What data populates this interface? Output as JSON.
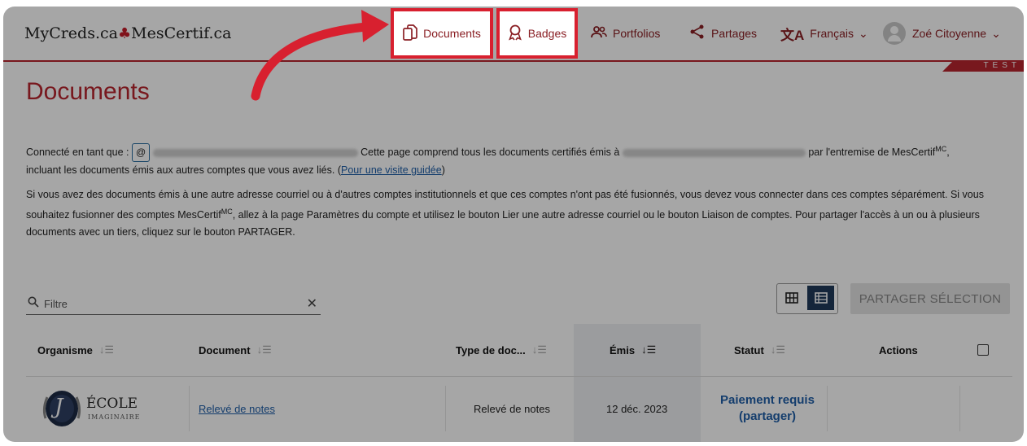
{
  "header": {
    "logo_left": "MyCreds.ca",
    "logo_right": "MesCertif.ca",
    "nav": {
      "documents": "Documents",
      "badges": "Badges",
      "portfolios": "Portfolios",
      "partages": "Partages",
      "language": "Français",
      "user": "Zoé Citoyenne"
    },
    "test_ribbon": "TEST"
  },
  "page": {
    "title": "Documents",
    "connected_as": "Connecté en tant que :",
    "at_symbol": "@",
    "para1_mid": "Cette page comprend tous les documents certifiés émis à",
    "para1_end": "par l'entremise de MesCertif",
    "mc": "MC",
    "para1_line2": "incluant les documents émis aux autres comptes que vous avez liés.",
    "guided_tour": "Pour une visite guidée",
    "para2_a": "Si vous avez des documents émis à une autre adresse courriel ou à d'autres comptes institutionnels et que ces comptes n'ont pas été fusionnés, vous devez vous connecter dans ces comptes séparément. Si vous souhaitez fusionner des comptes MesCertif",
    "para2_b": ", allez à la page Paramètres du compte et utilisez le bouton Lier une autre adresse courriel ou le bouton Liaison de comptes. Pour partager l'accès à un ou à plusieurs documents avec un tiers, cliquez sur le bouton PARTAGER."
  },
  "filter": {
    "placeholder": "Filtre",
    "clear": "✕"
  },
  "share_selection": "PARTAGER SÉLECTION",
  "table": {
    "headers": {
      "organisme": "Organisme",
      "document": "Document",
      "type": "Type de doc...",
      "emis": "Émis",
      "statut": "Statut",
      "actions": "Actions"
    },
    "rows": [
      {
        "org_name": "ÉCOLE",
        "org_sub": "IMAGINAIRE",
        "org_initial": "J",
        "document": "Relevé de notes",
        "type": "Relevé de notes",
        "emis": "12 déc. 2023",
        "status_line1": "Paiement requis",
        "status_line2": "(partager)"
      }
    ]
  },
  "colors": {
    "brand_red": "#b8252e",
    "link_blue": "#1f5fa8",
    "highlight": "#d8202f"
  }
}
